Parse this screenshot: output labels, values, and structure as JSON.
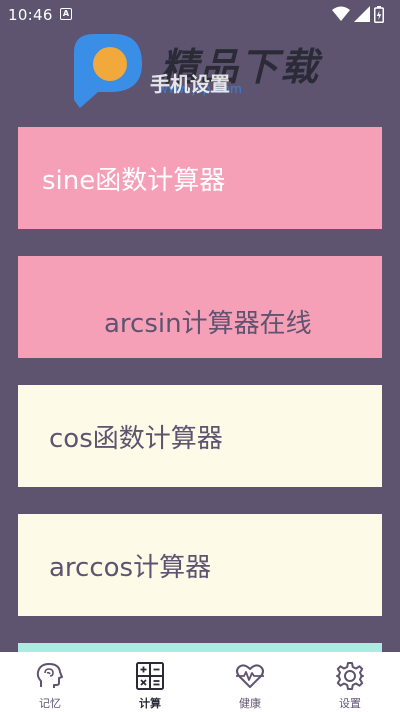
{
  "status_bar": {
    "time": "10:46",
    "app_icon_letter": "A"
  },
  "watermark": {
    "brand": "精品下载",
    "url": "www.jsp.com"
  },
  "header": {
    "title": "手机设置"
  },
  "cards": [
    {
      "label": "sine函数计算器",
      "color": "#f6a0b8"
    },
    {
      "label": "arcsin计算器在线",
      "color": "#f6a0b8"
    },
    {
      "label": "cos函数计算器",
      "color": "#fdfae8"
    },
    {
      "label": "arccos计算器",
      "color": "#fdfae8"
    },
    {
      "label": "",
      "color": "#a8ece2"
    }
  ],
  "bottom_nav": {
    "items": [
      {
        "label": "记忆",
        "icon": "brain-head-icon"
      },
      {
        "label": "计算",
        "icon": "calculator-icon",
        "active": true
      },
      {
        "label": "健康",
        "icon": "heart-pulse-icon"
      },
      {
        "label": "设置",
        "icon": "gear-icon"
      }
    ]
  },
  "colors": {
    "background": "#5e5470",
    "pink": "#f6a0b8",
    "cream": "#fdfae8",
    "mint": "#a8ece2"
  }
}
